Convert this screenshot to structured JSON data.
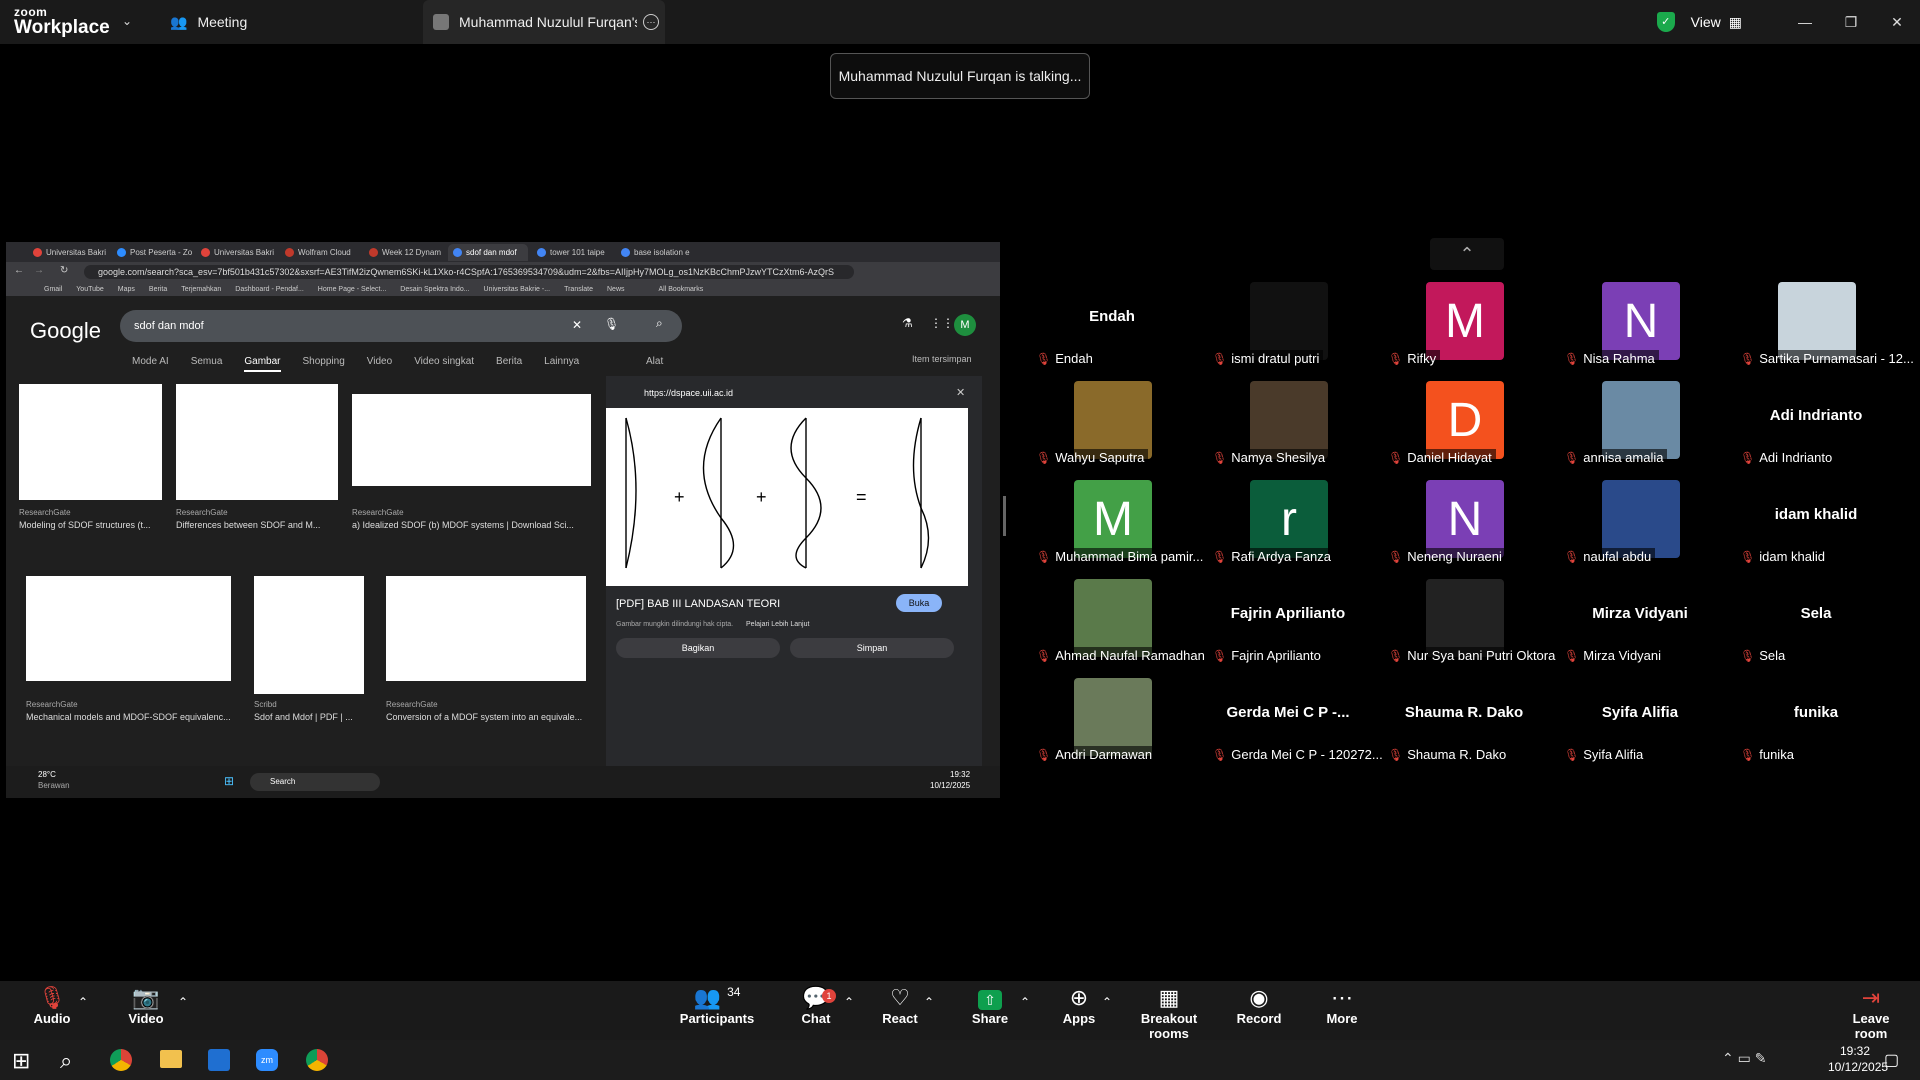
{
  "topbar": {
    "logo_top": "zoom",
    "logo_bottom": "Workplace",
    "meeting_tab": "Meeting",
    "share_tab": "Muhammad Nuzulul Furqan's scr",
    "view_label": "View"
  },
  "talking_banner": "Muhammad Nuzulul Furqan is talking...",
  "shared_screen": {
    "browser_tabs": [
      "Universitas Bakri",
      "Post Peserta - Zo",
      "Universitas Bakri",
      "Wolfram Cloud",
      "Week 12 Dynam",
      "sdof dan mdof",
      "tower 101 taipe",
      "base isolation e"
    ],
    "url": "google.com/search?sca_esv=7bf501b431c57302&sxsrf=AE3TifM2izQwnem6SKi-kL1Xko-r4CSpfA:1765369534709&udm=2&fbs=AIIjpHy7MOLg_os1NzKBcChmPJzwYTCzXtm6-AzQrS",
    "bookmarks": [
      "Gmail",
      "YouTube",
      "Maps",
      "Berita",
      "Terjemahkan",
      "Dashboard - Pendaf...",
      "Home Page - Select...",
      "Desain Spektra Indo...",
      "Universitas Bakrie -...",
      "Translate",
      "News",
      "All Bookmarks"
    ],
    "google_logo": "Google",
    "search_query": "sdof dan mdof",
    "search_tabs": [
      "Mode AI",
      "Semua",
      "Gambar",
      "Shopping",
      "Video",
      "Video singkat",
      "Berita",
      "Lainnya"
    ],
    "active_search_tab": "Gambar",
    "tools_label": "Alat",
    "saved_label": "Item tersimpan",
    "results": [
      {
        "source": "ResearchGate",
        "caption": "Modeling of SDOF structures (t..."
      },
      {
        "source": "ResearchGate",
        "caption": "Differences between SDOF and M..."
      },
      {
        "source": "ResearchGate",
        "caption": "a) Idealized SDOF (b) MDOF systems | Download Sci..."
      },
      {
        "source": "ResearchGate",
        "caption": "Mechanical models and MDOF-SDOF equivalenc..."
      },
      {
        "source": "Scribd",
        "caption": "Sdof and Mdof | PDF | ..."
      },
      {
        "source": "ResearchGate",
        "caption": "Conversion of a MDOF system into an equivale..."
      }
    ],
    "preview": {
      "domain": "https://dspace.uii.ac.id",
      "title": "[PDF] BAB III LANDASAN TEORI",
      "open_label": "Buka",
      "copyright": "Gambar mungkin dilindungi hak cipta.",
      "learn_more": "Pelajari Lebih Lanjut",
      "share_label": "Bagikan",
      "save_label": "Simpan"
    },
    "taskbar": {
      "weather": "28°C",
      "weather_desc": "Berawan",
      "search": "Search",
      "time": "19:32",
      "date": "10/12/2025"
    }
  },
  "gallery": [
    {
      "name": "Endah",
      "big": "Endah",
      "type": "text"
    },
    {
      "name": "ismi dratul putri",
      "big": "",
      "type": "dark"
    },
    {
      "name": "Rifky",
      "big": "M",
      "type": "letter",
      "color": "#c2185b"
    },
    {
      "name": "Nisa Rahma",
      "big": "N",
      "type": "letter",
      "color": "#7b3fb5"
    },
    {
      "name": "Sartika Purnamasari - 12...",
      "big": "",
      "type": "photo",
      "color": "#c8d4dc"
    },
    {
      "name": "Wahyu Saputra",
      "big": "",
      "type": "photo",
      "color": "#8a6a2a"
    },
    {
      "name": "Namya Shesilya",
      "big": "",
      "type": "photo",
      "color": "#4a3a2a"
    },
    {
      "name": "Daniel Hidayat",
      "big": "D",
      "type": "letter",
      "color": "#f4511e"
    },
    {
      "name": "annisa amalia",
      "big": "",
      "type": "photo",
      "color": "#6a8aa4"
    },
    {
      "name": "Adi Indrianto",
      "big": "Adi Indrianto",
      "type": "text"
    },
    {
      "name": "Muhammad Bima pamir...",
      "big": "M",
      "type": "letter",
      "color": "#43a047"
    },
    {
      "name": "Rafi Ardya Fanza",
      "big": "r",
      "type": "letter",
      "color": "#0b5d3b"
    },
    {
      "name": "Neneng Nuraeni",
      "big": "N",
      "type": "letter",
      "color": "#7b3fb5"
    },
    {
      "name": "naufal abdu",
      "big": "",
      "type": "photo",
      "color": "#2a4a8a"
    },
    {
      "name": "idam khalid",
      "big": "idam khalid",
      "type": "text"
    },
    {
      "name": "Ahmad Naufal Ramadhan",
      "big": "",
      "type": "photo",
      "color": "#5a7a4a"
    },
    {
      "name": "Fajrin Aprilianto",
      "big": "Fajrin Aprilianto",
      "type": "text"
    },
    {
      "name": "Nur Sya bani Putri Oktora",
      "big": "",
      "type": "photo",
      "color": "#222"
    },
    {
      "name": "Mirza Vidyani",
      "big": "Mirza Vidyani",
      "type": "text"
    },
    {
      "name": "Sela",
      "big": "Sela",
      "type": "text"
    },
    {
      "name": "Andri Darmawan",
      "big": "",
      "type": "photo",
      "color": "#6a7a5a"
    },
    {
      "name": "Gerda Mei C P - 120272...",
      "big": "Gerda Mei C P -...",
      "type": "text"
    },
    {
      "name": "Shauma R. Dako",
      "big": "Shauma R. Dako",
      "type": "text"
    },
    {
      "name": "Syifa Alifia",
      "big": "Syifa Alifia",
      "type": "text"
    },
    {
      "name": "funika",
      "big": "funika",
      "type": "text"
    }
  ],
  "toolbar": {
    "audio": "Audio",
    "video": "Video",
    "participants": "Participants",
    "participants_count": "34",
    "chat": "Chat",
    "chat_badge": "1",
    "react": "React",
    "share": "Share",
    "apps": "Apps",
    "breakout": "Breakout rooms",
    "record": "Record",
    "more": "More",
    "leave": "Leave room"
  },
  "windows_taskbar": {
    "time": "19:32",
    "date": "10/12/2025"
  },
  "colors": {
    "share_green": "#0e9f4e",
    "mute_red": "#e0433b",
    "zoom_bg": "#000000"
  }
}
